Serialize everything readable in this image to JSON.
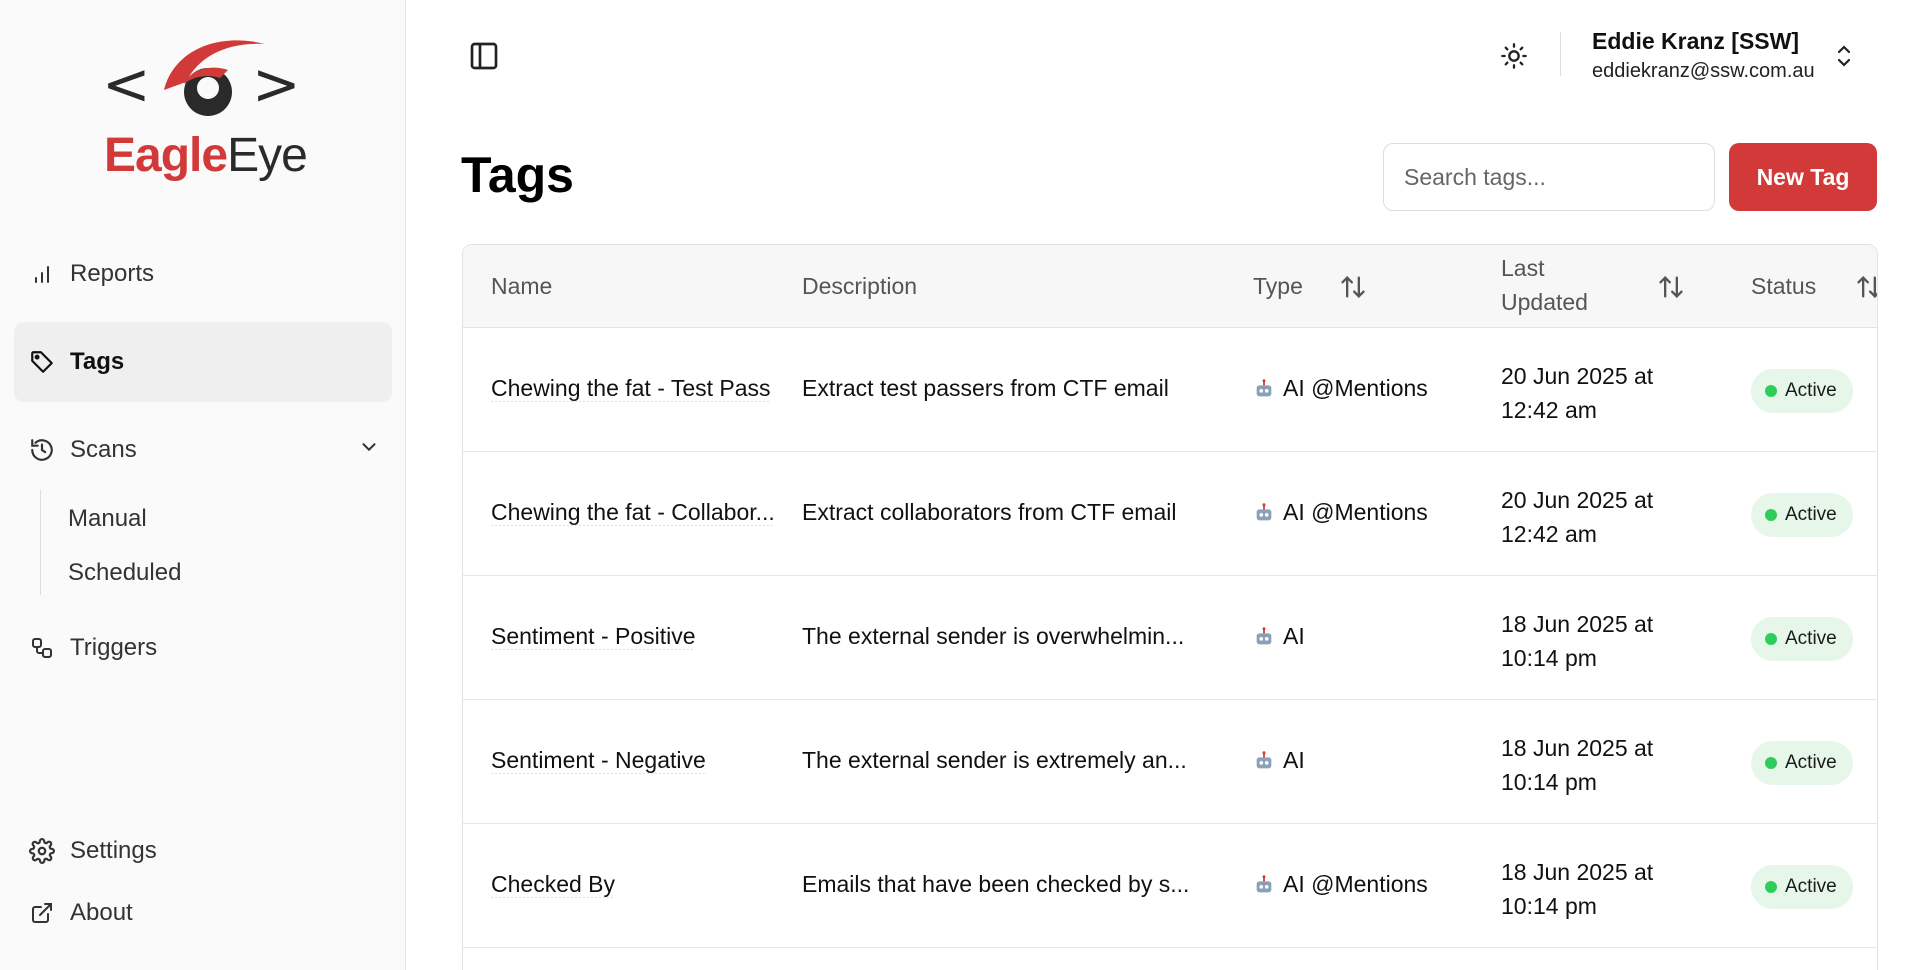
{
  "app": {
    "logo_left": "<",
    "logo_right": ">",
    "logo_text_bold": "Eagle",
    "logo_text_light": "Eye",
    "brand_color": "#d23a3a"
  },
  "sidebar": {
    "items": [
      {
        "label": "Reports",
        "icon": "bar-chart-icon"
      },
      {
        "label": "Tags",
        "icon": "tag-icon",
        "active": true
      },
      {
        "label": "Scans",
        "icon": "history-icon",
        "expanded": true
      },
      {
        "label": "Triggers",
        "icon": "workflow-icon"
      }
    ],
    "scans_sub": [
      "Manual",
      "Scheduled"
    ],
    "bottom": [
      {
        "label": "Settings",
        "icon": "gear-icon"
      },
      {
        "label": "About",
        "icon": "external-link-icon"
      }
    ]
  },
  "header": {
    "user_name": "Eddie Kranz [SSW]",
    "user_email": "eddiekranz@ssw.com.au"
  },
  "page": {
    "title": "Tags",
    "search_placeholder": "Search tags...",
    "new_button": "New Tag"
  },
  "table": {
    "columns": [
      "Name",
      "Description",
      "Type",
      "Last",
      "Updated",
      "Status"
    ],
    "rows": [
      {
        "name": "Chewing the fat - Test Pass",
        "description": "Extract test passers from CTF email",
        "type": "AI @Mentions",
        "date_line1": "20 Jun 2025 at",
        "date_line2": "12:42 am",
        "status": "Active"
      },
      {
        "name": "Chewing the fat - Collabor...",
        "description": "Extract collaborators from CTF email",
        "type": "AI @Mentions",
        "date_line1": "20 Jun 2025 at",
        "date_line2": "12:42 am",
        "status": "Active"
      },
      {
        "name": "Sentiment - Positive",
        "description": "The external sender is overwhelmin...",
        "type": "AI",
        "date_line1": "18 Jun 2025 at",
        "date_line2": "10:14 pm",
        "status": "Active"
      },
      {
        "name": "Sentiment - Negative",
        "description": "The external sender is extremely an...",
        "type": "AI",
        "date_line1": "18 Jun 2025 at",
        "date_line2": "10:14 pm",
        "status": "Active"
      },
      {
        "name": "Checked By",
        "description": "Emails that have been checked by s...",
        "type": "AI @Mentions",
        "date_line1": "18 Jun 2025 at",
        "date_line2": "10:14 pm",
        "status": "Active"
      }
    ]
  }
}
